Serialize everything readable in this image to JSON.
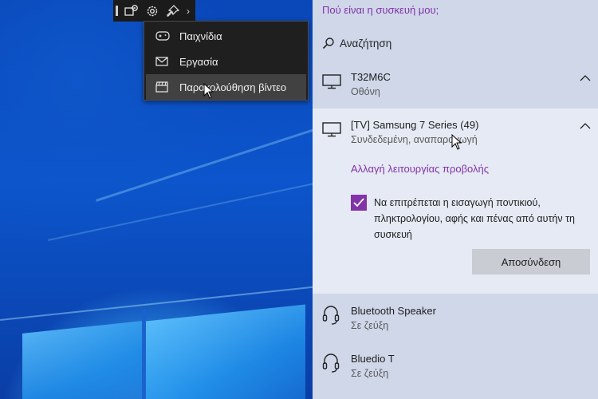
{
  "gamebar": {
    "icons": [
      "screen-capture-icon",
      "settings-icon",
      "pin-icon",
      "chevron-right-icon"
    ],
    "chevron": "›",
    "menu": [
      {
        "label": "Παιχνίδια",
        "icon": "gamepad-icon"
      },
      {
        "label": "Εργασία",
        "icon": "mail-icon"
      },
      {
        "label": "Παρακολούθηση βίντεο",
        "icon": "video-clapper-icon",
        "hovered": true
      }
    ]
  },
  "panel": {
    "where_link": "Πού είναι η συσκευή μου;",
    "search_label": "Αναζήτηση",
    "devices": [
      {
        "name": "T32M6C",
        "subtitle": "Οθόνη",
        "icon": "monitor-icon",
        "expanded": false
      },
      {
        "name": "[TV] Samsung 7 Series (49)",
        "subtitle": "Συνδεδεμένη, αναπαραγωγή",
        "icon": "monitor-icon",
        "expanded": true,
        "projection_link": "Αλλαγή λειτουργίας προβολής",
        "checkbox_text": "Να επιτρέπεται η εισαγωγή ποντικιού, πληκτρολογίου, αφής και πένας από αυτήν τη συσκευή",
        "checkbox_checked": true,
        "disconnect_label": "Αποσύνδεση"
      },
      {
        "name": "Bluetooth Speaker",
        "subtitle": "Σε ζεύξη",
        "icon": "headset-icon"
      },
      {
        "name": "Bluedio T",
        "subtitle": "Σε ζεύξη",
        "icon": "headset-icon"
      }
    ]
  },
  "colors": {
    "accent": "#8233a8",
    "panel_bg": "#cfd7e9",
    "expanded_bg": "#e5eaf4"
  }
}
